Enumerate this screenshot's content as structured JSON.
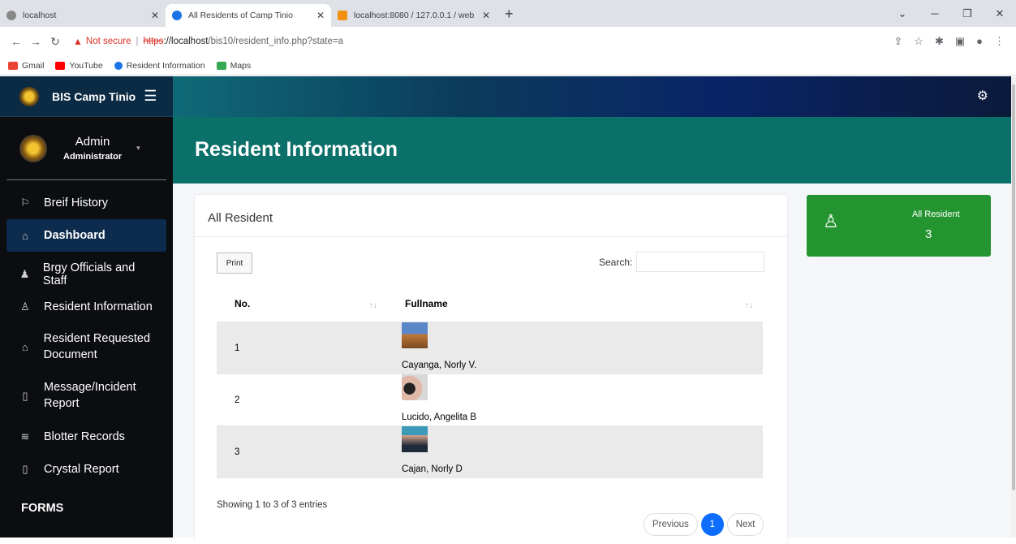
{
  "browser": {
    "tabs": [
      {
        "label": "localhost",
        "active": false
      },
      {
        "label": "All Residents of Camp Tinio",
        "active": true
      },
      {
        "label": "localhost:8080 / 127.0.0.1 / web",
        "active": false
      }
    ],
    "address": {
      "warning": "Not secure",
      "scheme": "https",
      "host": "://localhost",
      "path": "/bis10/resident_info.php?state=a"
    },
    "bookmarks": [
      "Gmail",
      "YouTube",
      "Resident Information",
      "Maps"
    ]
  },
  "sidebar": {
    "brand": "BIS Camp Tinio",
    "user_name": "Admin",
    "user_role": "Administrator",
    "items": [
      {
        "label": "Breif History",
        "icon": "signpost-icon"
      },
      {
        "label": "Dashboard",
        "icon": "home-icon",
        "active": true
      },
      {
        "label": "Brgy Officials and Staff",
        "icon": "users-icon"
      },
      {
        "label": "Resident Information",
        "icon": "user-outline-icon"
      },
      {
        "label": "Resident Requested Document",
        "icon": "home-icon"
      },
      {
        "label": "Message/Incident Report",
        "icon": "file-icon"
      },
      {
        "label": "Blotter Records",
        "icon": "layers-icon"
      },
      {
        "label": "Crystal Report",
        "icon": "file-icon"
      }
    ],
    "section_forms": "FORMS"
  },
  "page": {
    "title": "Resident Information"
  },
  "card": {
    "title": "All Resident",
    "print_label": "Print",
    "search_label": "Search:",
    "search_value": "",
    "columns": [
      "No.",
      "Fullname"
    ],
    "rows": [
      {
        "no": "1",
        "name": "Cayanga, Norly V."
      },
      {
        "no": "2",
        "name": "Lucido, Angelita B"
      },
      {
        "no": "3",
        "name": "Cajan, Norly D"
      }
    ],
    "showing_prefix": "Showing",
    "showing_start": "1",
    "showing_to": "to",
    "showing_end": "3",
    "showing_of": "of",
    "showing_total": "3",
    "showing_suffix": "entries",
    "prev_label": "Previous",
    "current_page": "1",
    "next_label": "Next"
  },
  "stat": {
    "label": "All Resident",
    "value": "3",
    "color": "#23942f"
  }
}
